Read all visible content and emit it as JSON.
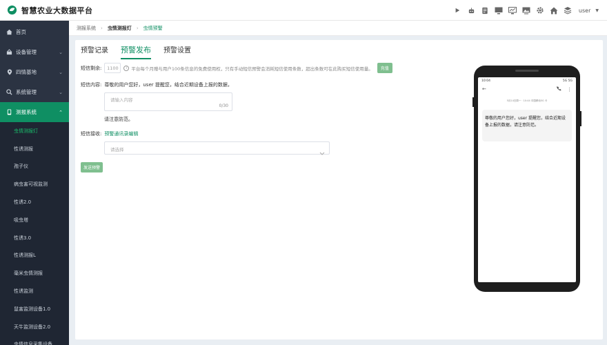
{
  "app": {
    "title": "智慧农业大数据平台",
    "user": "user"
  },
  "header": {
    "icons": [
      "play-icon",
      "robot-icon",
      "document-icon",
      "monitor-icon",
      "chart-monitor-icon",
      "image-icon",
      "gear-icon",
      "home-icon",
      "layers-icon"
    ]
  },
  "sidebar": {
    "items": [
      {
        "label": "首页",
        "icon": "home-icon"
      },
      {
        "label": "设备管理",
        "icon": "device-icon"
      },
      {
        "label": "四情基地",
        "icon": "location-icon"
      },
      {
        "label": "系统管理",
        "icon": "settings-icon"
      },
      {
        "label": "测报系统",
        "icon": "phone-icon"
      }
    ],
    "sub_items": [
      "虫情测报灯",
      "性诱测报",
      "孢子仪",
      "病虫害可视监测",
      "性诱2.0",
      "吸虫塔",
      "性诱3.0",
      "性诱测报L",
      "毫米虫情测报",
      "性诱监测",
      "鼠害监测设备1.0",
      "天牛监测设备2.0",
      "虫情信息采集设备"
    ]
  },
  "breadcrumb": {
    "level1": "测报系统",
    "level2": "虫情测报灯",
    "level3": "虫情预警"
  },
  "tabs": [
    "预警记录",
    "预警发布",
    "预警设置"
  ],
  "form": {
    "remaining_label": "短信剩余:",
    "remaining_value": "1100",
    "remaining_hint": "平台每个月赠与用户100条信息的免费使用权，只有手动短信预警会消耗短信使用条数，超出条数可在此购买短信使用量。",
    "recharge_button": "充值",
    "content_label": "短信内容:",
    "content_prefix": "尊敬的用户您好，user 提醒您，结合近期设备上报的数据，",
    "content_placeholder": "请输入内容",
    "content_counter": "0/30",
    "content_suffix": "请注意防范。",
    "receiver_label": "短信接收:",
    "receiver_link": "预警通讯录编辑",
    "receiver_placeholder": "请选择",
    "send_button": "发送预警"
  },
  "phone": {
    "status_time": "10:04",
    "status_right": "5G 5G",
    "msg_time": "5月14日周一 · 10:44 中国移动5G 卡",
    "message": "尊敬的用户您好，user 提醒您，结合近期设备上报的数据，请注意防范。"
  },
  "colors": {
    "accent": "#0f8f63",
    "sidebar_bg": "#2b3342"
  }
}
